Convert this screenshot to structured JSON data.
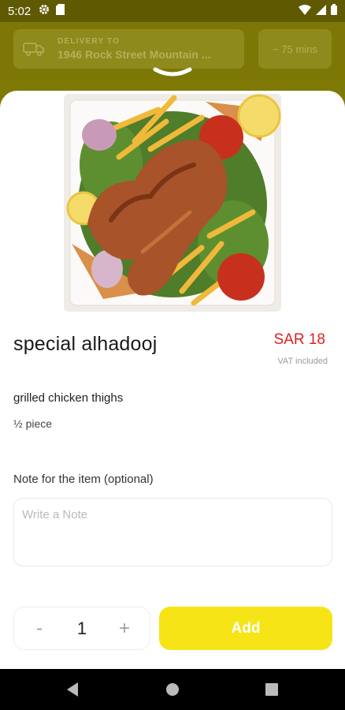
{
  "status_bar": {
    "time": "5:02"
  },
  "header": {
    "delivery_label": "DELIVERY TO",
    "address": "1946 Rock Street Mountain ...",
    "eta": "~ 75 mins"
  },
  "item": {
    "name": "special alhadooj",
    "price": "SAR 18",
    "vat_note": "VAT included",
    "description": "grilled chicken thighs",
    "portion": "½ piece"
  },
  "note": {
    "label": "Note for the item (optional)",
    "placeholder": "Write a Note",
    "value": ""
  },
  "quantity": {
    "minus": "-",
    "value": "1",
    "plus": "+"
  },
  "actions": {
    "add_label": "Add"
  },
  "colors": {
    "accent": "#f6e416",
    "price": "#e02020",
    "header_dim": "#7d7806"
  }
}
